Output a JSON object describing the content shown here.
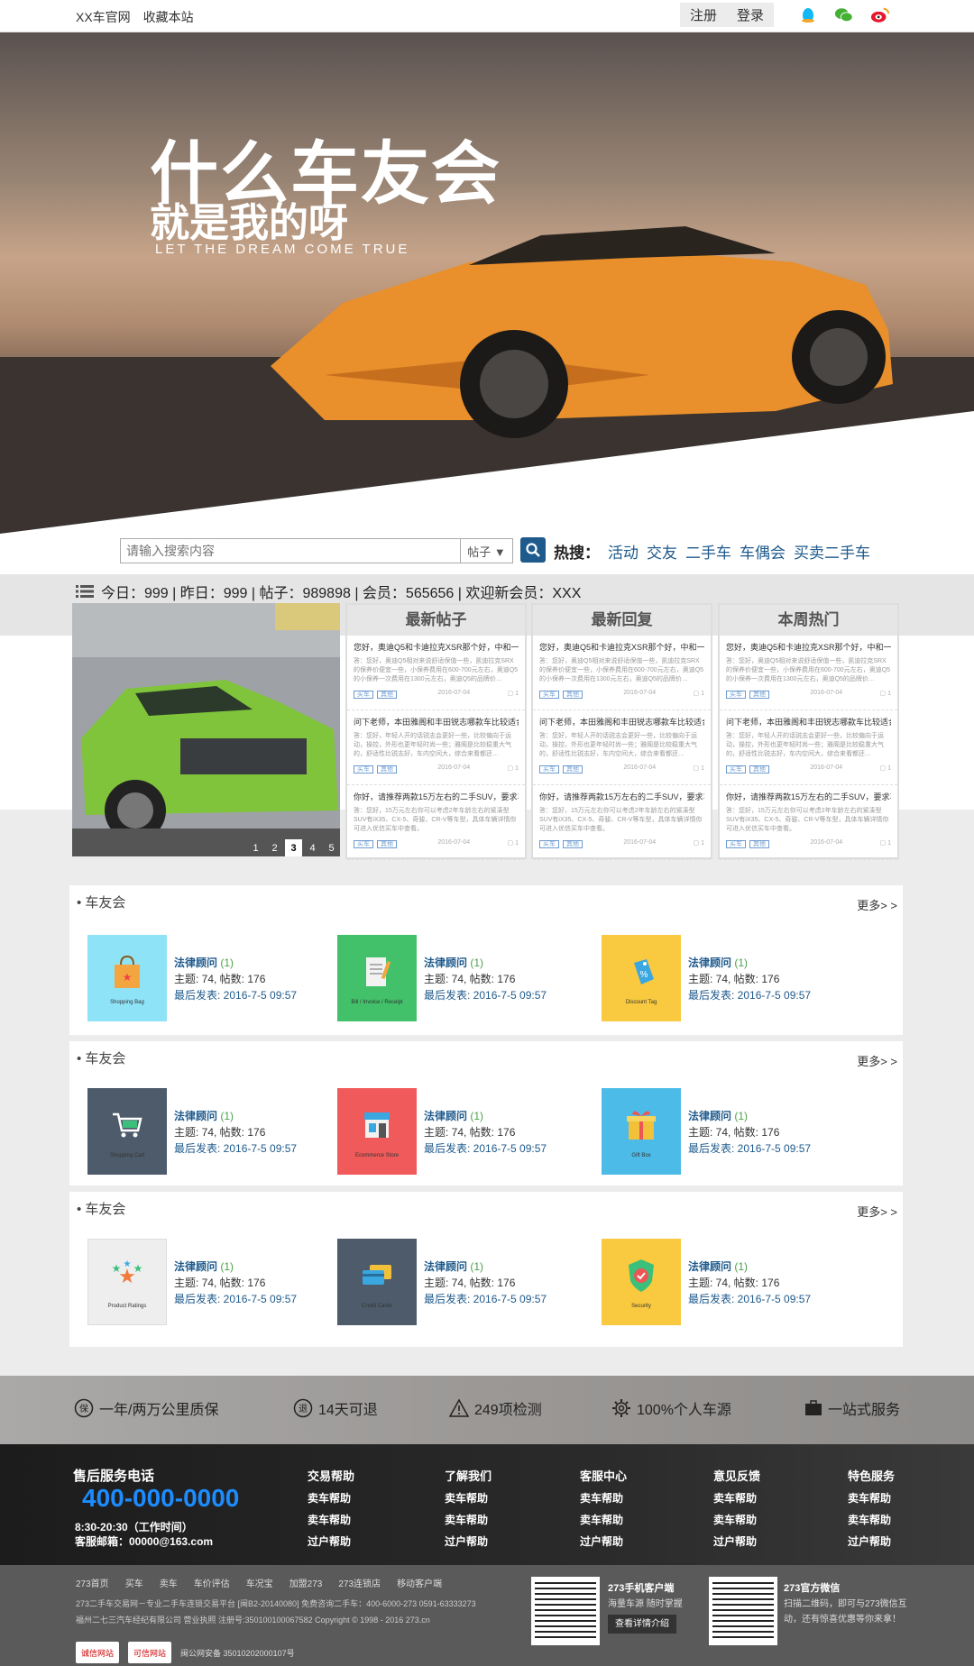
{
  "topbar": {
    "site_name": "XX车官网",
    "bookmark": "收藏本站",
    "register": "注册",
    "login": "登录"
  },
  "hero": {
    "title": "什么车友会",
    "subtitle": "就是我的呀",
    "tagline": "LET THE DREAM COME TRUE"
  },
  "search": {
    "placeholder": "请输入搜索内容",
    "select_value": "帖子 ▼",
    "hot_label": "热搜：",
    "hot_links": [
      "活动",
      "交友",
      "二手车",
      "车偶会",
      "买卖二手车"
    ]
  },
  "stats": {
    "text": "今日：999 | 昨日：999 | 帖子：989898 | 会员：565656 | 欢迎新会员：XXX"
  },
  "slider": {
    "pages": [
      "1",
      "2",
      "3",
      "4",
      "5"
    ],
    "active": "3"
  },
  "columns": [
    {
      "title": "最新帖子",
      "posts": [
        {
          "q": "您好，奥迪Q5和卡迪拉克XSR那个好，中和一下…",
          "a": "答：您好，奥迪Q5相对来说舒适保值一些，凯迪拉克SRX的保养价便宜一些，小保养费用在600-700元左右，奥迪Q5的小保养一次费用在1300元左右，奥迪Q5的品牌价…",
          "tags": [
            "买车",
            "其他"
          ],
          "date": "2016-07-04",
          "count": "1"
        },
        {
          "q": "问下老师，本田雅阁和丰田锐志哪款车比较适合…",
          "a": "答：您好，年轻人开的话锐志会更好一些，比较偏向于运动，操控，外形也更年轻时尚一些；雅阁是比较稳重大气的，舒适性比锐志好，车内空间大，综合来看都还…",
          "tags": [
            "买车",
            "其他"
          ],
          "date": "2016-07-04",
          "count": "1"
        },
        {
          "q": "你好，请推荐两款15万左右的二手SUV，要求车…",
          "a": "答：您好，15万元左右你可以考虑2年车龄左右的紧凑型SUV有iX35、CX-5、奇骏、CR-V等车型，具体车辆详情你可进入优信买车中查看。",
          "tags": [
            "买车",
            "其他"
          ],
          "date": "2016-07-04",
          "count": "1"
        }
      ]
    },
    {
      "title": "最新回复",
      "posts": [
        {
          "q": "您好，奥迪Q5和卡迪拉克XSR那个好，中和一下…",
          "a": "答：您好，奥迪Q5相对来说舒适保值一些，凯迪拉克SRX的保养价便宜一些，小保养费用在600-700元左右，奥迪Q5的小保养一次费用在1300元左右，奥迪Q5的品牌价…",
          "tags": [
            "买车",
            "其他"
          ],
          "date": "2016-07-04",
          "count": "1"
        },
        {
          "q": "问下老师，本田雅阁和丰田锐志哪款车比较适合…",
          "a": "答：您好，年轻人开的话锐志会更好一些，比较偏向于运动，操控，外形也更年轻时尚一些；雅阁是比较稳重大气的，舒适性比锐志好，车内空间大，综合来看都还…",
          "tags": [
            "买车",
            "其他"
          ],
          "date": "2016-07-04",
          "count": "1"
        },
        {
          "q": "你好，请推荐两款15万左右的二手SUV，要求车…",
          "a": "答：您好，15万元左右你可以考虑2年车龄左右的紧凑型SUV有iX35、CX-5、奇骏、CR-V等车型，具体车辆详情你可进入优信买车中查看。",
          "tags": [
            "买车",
            "其他"
          ],
          "date": "2016-07-04",
          "count": "1"
        }
      ]
    },
    {
      "title": "本周热门",
      "posts": [
        {
          "q": "您好，奥迪Q5和卡迪拉克XSR那个好，中和一下…",
          "a": "答：您好，奥迪Q5相对来说舒适保值一些，凯迪拉克SRX的保养价便宜一些，小保养费用在600-700元左右，奥迪Q5的小保养一次费用在1300元左右，奥迪Q5的品牌价…",
          "tags": [
            "买车",
            "其他"
          ],
          "date": "2016-07-04",
          "count": "1"
        },
        {
          "q": "问下老师，本田雅阁和丰田锐志哪款车比较适合…",
          "a": "答：您好，年轻人开的话锐志会更好一些，比较偏向于运动，操控，外形也更年轻时尚一些；雅阁是比较稳重大气的，舒适性比锐志好，车内空间大，综合来看都还…",
          "tags": [
            "买车",
            "其他"
          ],
          "date": "2016-07-04",
          "count": "1"
        },
        {
          "q": "你好，请推荐两款15万左右的二手SUV，要求车…",
          "a": "答：您好，15万元左右你可以考虑2年车龄左右的紧凑型SUV有iX35、CX-5、奇骏、CR-V等车型，具体车辆详情你可进入优信买车中查看。",
          "tags": [
            "买车",
            "其他"
          ],
          "date": "2016-07-04",
          "count": "1"
        }
      ]
    }
  ],
  "forums": [
    {
      "title": "车友会",
      "more": "更多> >",
      "items": [
        {
          "icon": "shopping-bag-icon",
          "caption": "Shopping Bag",
          "bg": "#8fe3f7",
          "name": "法律顾问",
          "count": "(1)",
          "stats": "主题: 74, 帖数: 176",
          "last": "最后发表: 2016-7-5 09:57"
        },
        {
          "icon": "receipt-icon",
          "caption": "Bill / Invoice / Receipt",
          "bg": "#43c06a",
          "name": "法律顾问",
          "count": "(1)",
          "stats": "主题: 74, 帖数: 176",
          "last": "最后发表: 2016-7-5 09:57"
        },
        {
          "icon": "price-tag-icon",
          "caption": "Discount Tag",
          "bg": "#f9ca3f",
          "name": "法律顾问",
          "count": "(1)",
          "stats": "主题: 74, 帖数: 176",
          "last": "最后发表: 2016-7-5 09:57"
        }
      ]
    },
    {
      "title": "车友会",
      "more": "更多> >",
      "items": [
        {
          "icon": "shopping-cart-icon",
          "caption": "Shopping Cart",
          "bg": "#4d5b6a",
          "name": "法律顾问",
          "count": "(1)",
          "stats": "主题: 74, 帖数: 176",
          "last": "最后发表: 2016-7-5 09:57"
        },
        {
          "icon": "store-icon",
          "caption": "Ecommerce Store",
          "bg": "#f05a5a",
          "name": "法律顾问",
          "count": "(1)",
          "stats": "主题: 74, 帖数: 176",
          "last": "最后发表: 2016-7-5 09:57"
        },
        {
          "icon": "gift-box-icon",
          "caption": "Gift Box",
          "bg": "#4dbbe8",
          "name": "法律顾问",
          "count": "(1)",
          "stats": "主题: 74, 帖数: 176",
          "last": "最后发表: 2016-7-5 09:57"
        }
      ]
    },
    {
      "title": "车友会",
      "more": "更多> >",
      "items": [
        {
          "icon": "product-ratings-icon",
          "caption": "Product Ratings",
          "bg": "#eeeeee",
          "name": "法律顾问",
          "count": "(1)",
          "stats": "主题: 74, 帖数: 176",
          "last": "最后发表: 2016-7-5 09:57"
        },
        {
          "icon": "credit-cards-icon",
          "caption": "Credit Cards",
          "bg": "#4d5b6a",
          "name": "法律顾问",
          "count": "(1)",
          "stats": "主题: 74, 帖数: 176",
          "last": "最后发表: 2016-7-5 09:57"
        },
        {
          "icon": "security-shield-icon",
          "caption": "Security",
          "bg": "#f9ca3f",
          "name": "法律顾问",
          "count": "(1)",
          "stats": "主题: 74, 帖数: 176",
          "last": "最后发表: 2016-7-5 09:57"
        }
      ]
    }
  ],
  "features": [
    "一年/两万公里质保",
    "14天可退",
    "249项检测",
    "100%个人车源",
    "一站式服务"
  ],
  "footer": {
    "service_title": "售后服务电话",
    "phone": "400-000-0000",
    "hours": "8:30-20:30（工作时间）",
    "email": "客服邮箱：00000@163.com",
    "columns": [
      {
        "title": "交易帮助",
        "items": [
          "卖车帮助",
          "卖车帮助",
          "过户帮助"
        ]
      },
      {
        "title": "了解我们",
        "items": [
          "卖车帮助",
          "卖车帮助",
          "过户帮助"
        ]
      },
      {
        "title": "客服中心",
        "items": [
          "卖车帮助",
          "卖车帮助",
          "过户帮助"
        ]
      },
      {
        "title": "意见反馈",
        "items": [
          "卖车帮助",
          "卖车帮助",
          "过户帮助"
        ]
      },
      {
        "title": "特色服务",
        "items": [
          "卖车帮助",
          "卖车帮助",
          "过户帮助"
        ]
      }
    ]
  },
  "bottom": {
    "links": [
      "273首页",
      "买车",
      "卖车",
      "车价评估",
      "车况宝",
      "加盟273",
      "273连锁店",
      "移动客户端"
    ],
    "copy1": "273二手车交易网－专业二手车连锁交易平台 [闽B2-20140080]  免费咨询二手车：400-6000-273 0591-63333273",
    "copy2": "福州二七三汽车经纪有限公司 营业执照 注册号:350100100067582  Copyright © 1998 - 2016 273.cn",
    "badges": [
      "诚信网站",
      "可信网站",
      "闽公网安备 35010202000107号"
    ],
    "app_title": "273手机客户端",
    "app_desc": "海量车源 随时掌握",
    "app_btn": "查看详情介绍",
    "wx_title": "273官方微信",
    "wx_desc1": "扫描二维码，即可与273微信互",
    "wx_desc2": "动，还有惊喜优惠等你来拿！"
  }
}
